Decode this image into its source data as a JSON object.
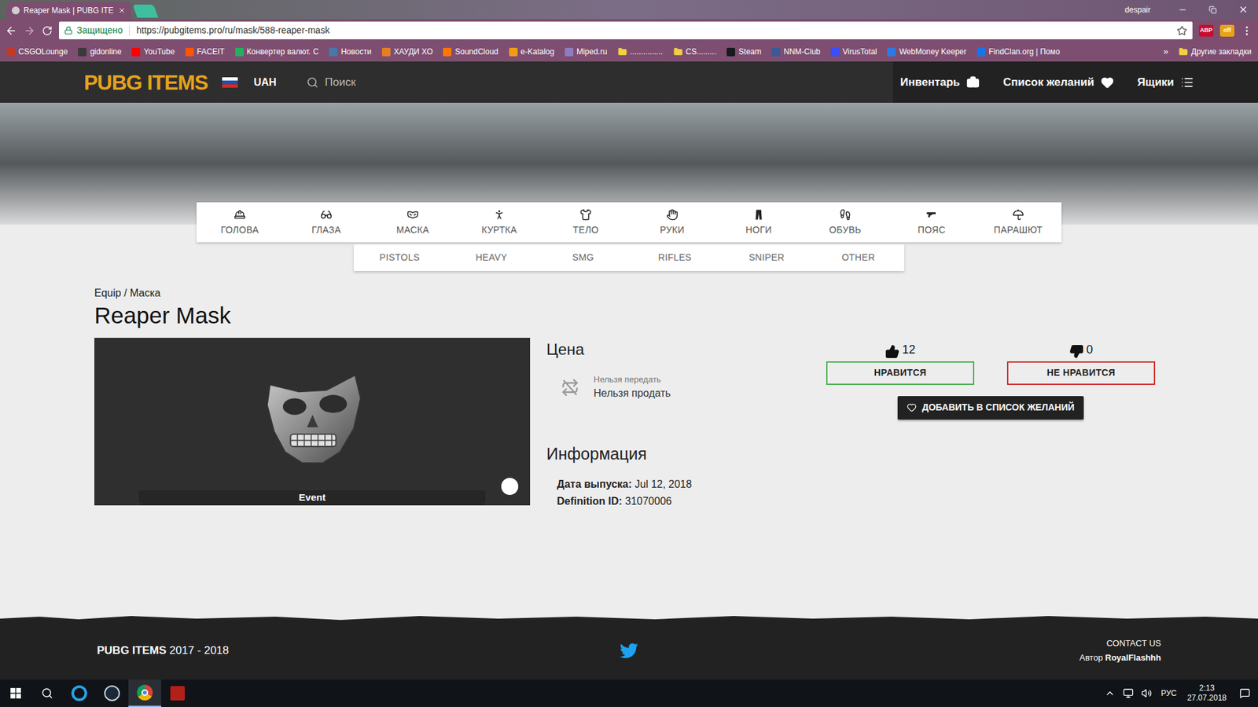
{
  "browser": {
    "tab_title": "Reaper Mask | PUBG ITE",
    "profile": "despair",
    "secure_label": "Защищено",
    "url": "https://pubgitems.pro/ru/mask/588-reaper-mask",
    "extensions": [
      {
        "label": "ABP",
        "color": "#c70d2c"
      },
      {
        "label": "off",
        "color": "#e8a317"
      }
    ],
    "bookmarks": [
      {
        "label": "CSGOLounge",
        "kind": "link",
        "color": "#c0392b"
      },
      {
        "label": "gidonline",
        "kind": "link",
        "color": "#3a3a3a"
      },
      {
        "label": "YouTube",
        "kind": "link",
        "color": "#ff0000"
      },
      {
        "label": "FACEIT",
        "kind": "link",
        "color": "#ff5500"
      },
      {
        "label": "Конвертер валют. С",
        "kind": "link",
        "color": "#27ae60"
      },
      {
        "label": "Новости",
        "kind": "link",
        "color": "#4a76a8"
      },
      {
        "label": "ХАУДИ ХО",
        "kind": "link",
        "color": "#e67e22"
      },
      {
        "label": "SoundCloud",
        "kind": "link",
        "color": "#ff7700"
      },
      {
        "label": "e-Katalog",
        "kind": "link",
        "color": "#f39c12"
      },
      {
        "label": "Miped.ru",
        "kind": "link",
        "color": "#8e7cc3"
      },
      {
        "label": "...............",
        "kind": "folder",
        "color": "#f4d03f"
      },
      {
        "label": "CS.........",
        "kind": "folder",
        "color": "#f4d03f"
      },
      {
        "label": "Steam",
        "kind": "link",
        "color": "#171a21"
      },
      {
        "label": "NNM-Club",
        "kind": "link",
        "color": "#3b5998"
      },
      {
        "label": "VirusTotal",
        "kind": "link",
        "color": "#394eff"
      },
      {
        "label": "WebMoney Keeper",
        "kind": "link",
        "color": "#2c7be5"
      },
      {
        "label": "FindClan.org | Помо",
        "kind": "link",
        "color": "#1a73e8"
      }
    ],
    "bookmarks_more": "»",
    "other_bookmarks": "Другие закладки"
  },
  "site": {
    "logo": "PUBG ITEMS",
    "currency": "UAH",
    "search_placeholder": "Поиск",
    "nav": [
      "Инвентарь",
      "Список желаний",
      "Ящики"
    ],
    "categories": [
      {
        "label": "ГОЛОВА",
        "selected": false
      },
      {
        "label": "ГЛАЗА",
        "selected": false
      },
      {
        "label": "МАСКА",
        "selected": false
      },
      {
        "label": "КУРТКА",
        "selected": false
      },
      {
        "label": "ТЕЛО",
        "selected": false
      },
      {
        "label": "РУКИ",
        "selected": false
      },
      {
        "label": "НОГИ",
        "selected": false
      },
      {
        "label": "ОБУВЬ",
        "selected": false
      },
      {
        "label": "ПОЯС",
        "selected": false
      },
      {
        "label": "ПАРАШЮТ",
        "selected": false
      }
    ],
    "weapons": [
      {
        "label": "PISTOLS",
        "selected": false
      },
      {
        "label": "HEAVY",
        "selected": false
      },
      {
        "label": "SMG",
        "selected": false
      },
      {
        "label": "RIFLES",
        "selected": false
      },
      {
        "label": "SNIPER",
        "selected": false
      },
      {
        "label": "OTHER",
        "selected": false
      }
    ]
  },
  "item": {
    "breadcrumb": "Equip / Маска",
    "title": "Reaper Mask",
    "rarity": "Event",
    "price_heading": "Цена",
    "trade_note": "Нельзя передать",
    "sell_note": "Нельзя продать",
    "info_heading": "Информация",
    "info": [
      {
        "label": "Дата выпуска:",
        "value": "Jul 12, 2018"
      },
      {
        "label": "Definition ID:",
        "value": "31070006"
      }
    ],
    "likes": "12",
    "like_button": "НРАВИТСЯ",
    "dislikes": "0",
    "dislike_button": "НЕ НРАВИТСЯ",
    "wishlist_button": "ДОБАВИТЬ В СПИСОК ЖЕЛАНИЙ"
  },
  "footer": {
    "brand": "PUBG ITEMS",
    "years": "2017 - 2018",
    "contact": "CONTACT US",
    "author_label": "Автор",
    "author": "RoyalFlashhh"
  },
  "taskbar": {
    "language": "РУС",
    "time": "2:13",
    "date": "27.07.2018"
  }
}
